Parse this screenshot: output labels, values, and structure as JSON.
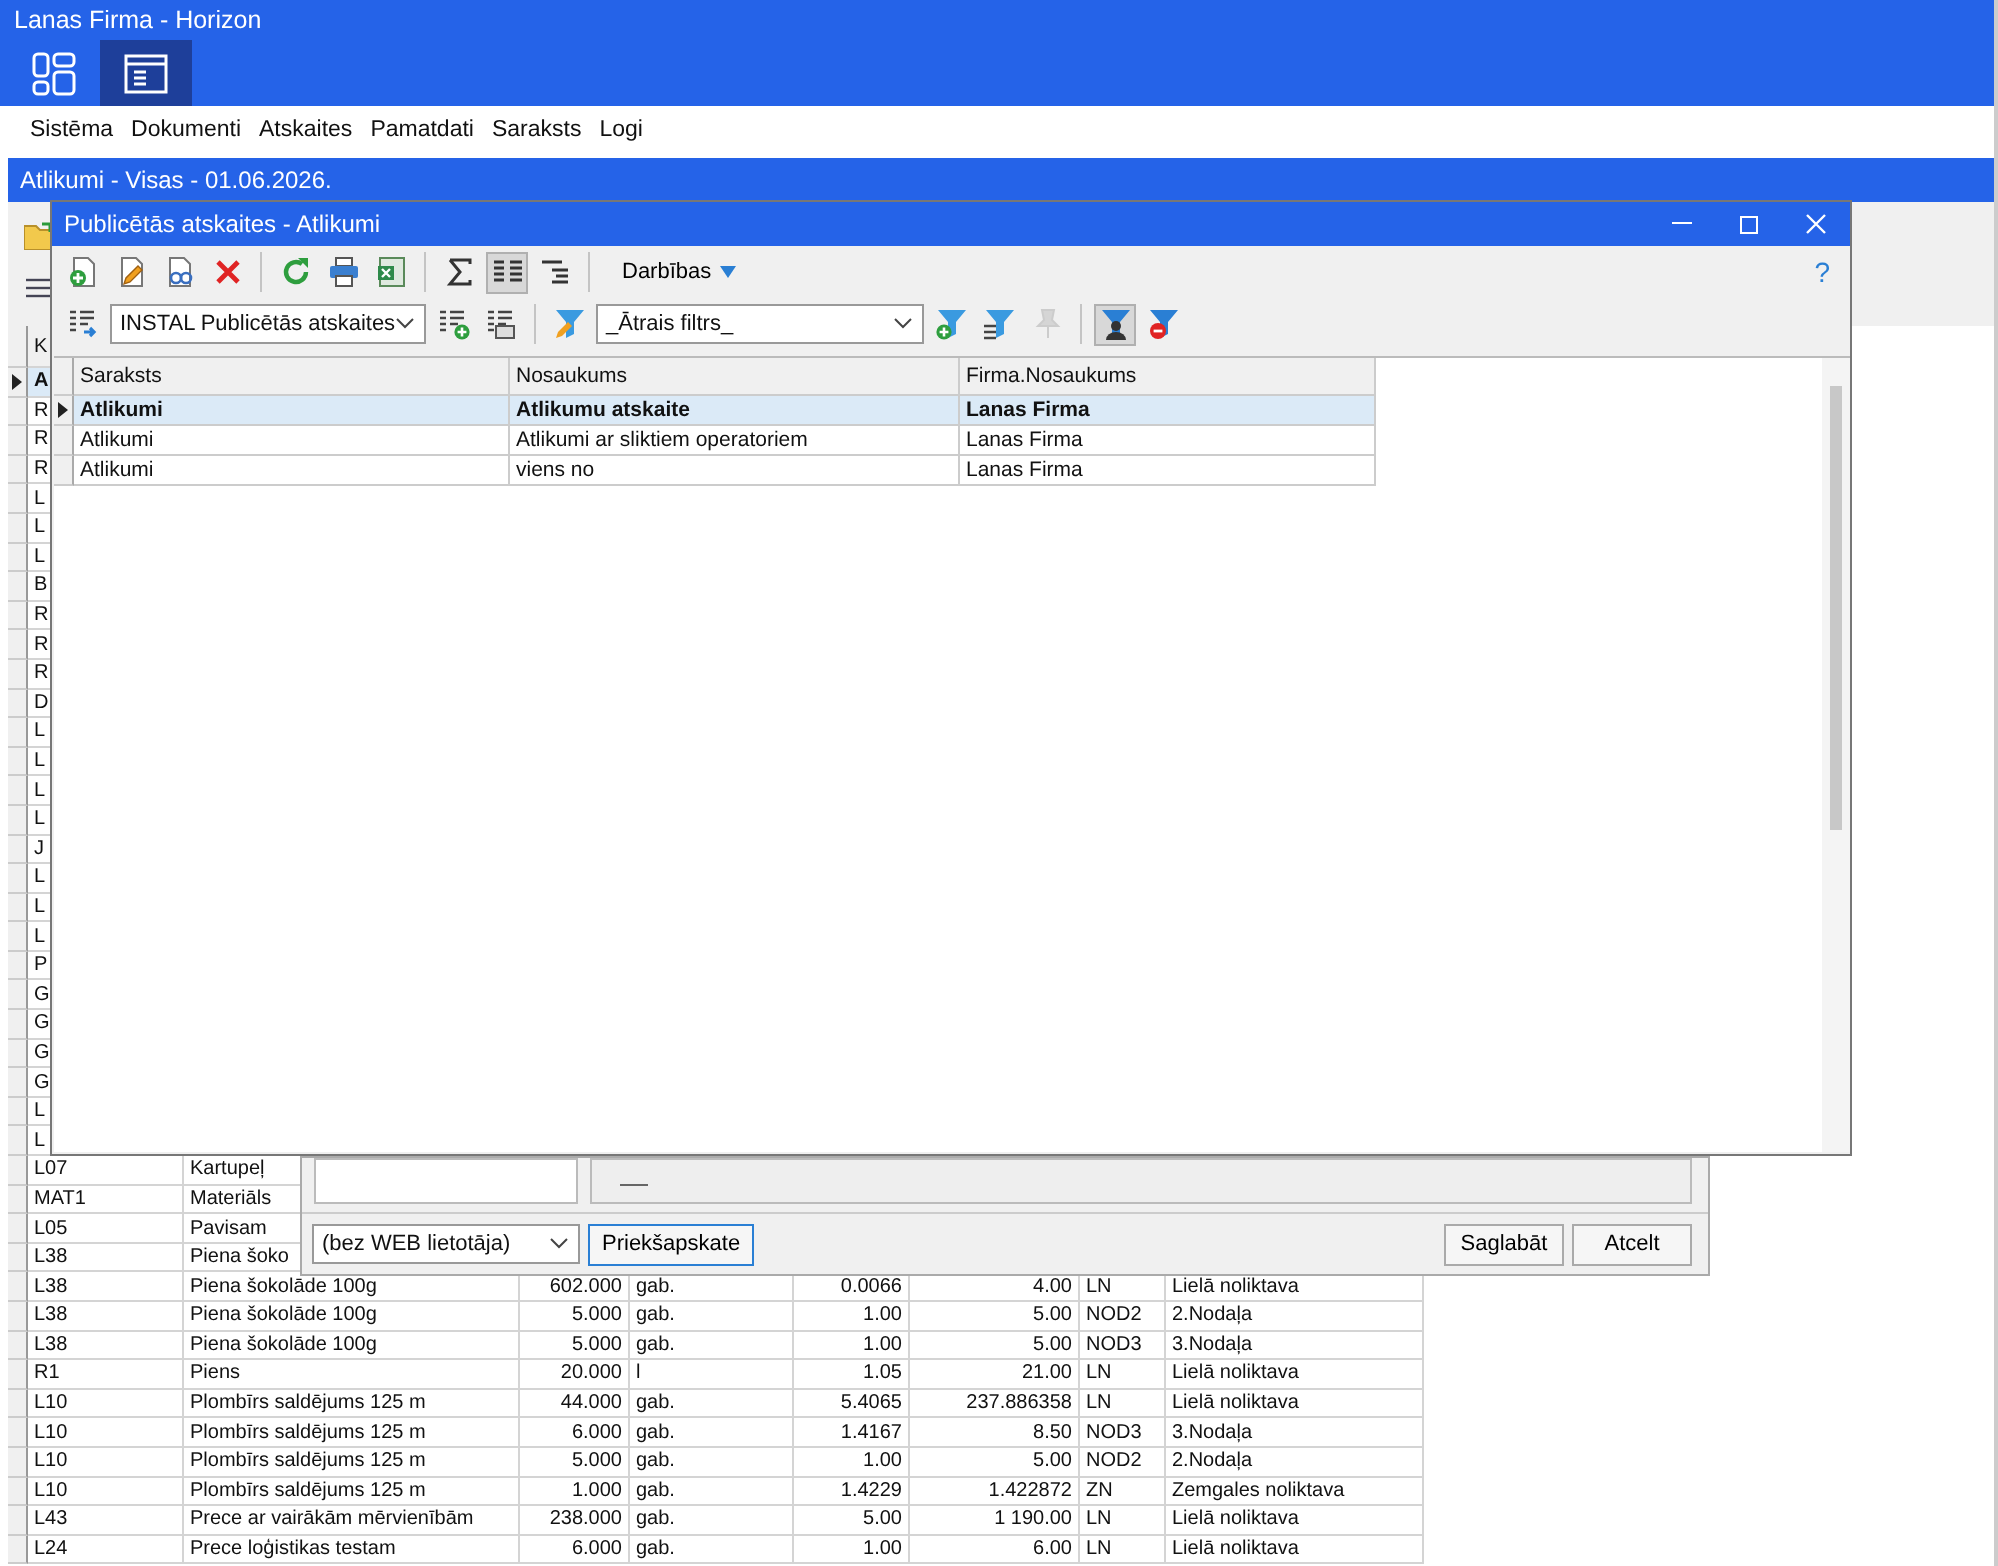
{
  "app": {
    "title": "Lanas Firma - Horizon"
  },
  "ribbon": [
    {
      "kind": "dashboard",
      "selected": false
    },
    {
      "kind": "window",
      "selected": true
    }
  ],
  "menu": [
    "Sistēma",
    "Dokumenti",
    "Atskaites",
    "Pamatdati",
    "Saraksts",
    "Logi"
  ],
  "stock_window": {
    "title": "Atlikumi - Visas - 01.06.2026.",
    "columns": [
      "K"
    ],
    "rows": [
      {
        "cells": [
          "A"
        ],
        "selected": true
      },
      {
        "cells": [
          "R"
        ],
        "selected": false
      },
      {
        "cells": [
          "R"
        ],
        "selected": false
      },
      {
        "cells": [
          "R"
        ],
        "selected": false
      },
      {
        "cells": [
          "L"
        ],
        "selected": false
      },
      {
        "cells": [
          "L"
        ],
        "selected": false
      },
      {
        "cells": [
          "L"
        ],
        "selected": false
      },
      {
        "cells": [
          "B"
        ],
        "selected": false
      },
      {
        "cells": [
          "R"
        ],
        "selected": false
      },
      {
        "cells": [
          "R"
        ],
        "selected": false
      },
      {
        "cells": [
          "R"
        ],
        "selected": false
      },
      {
        "cells": [
          "D"
        ],
        "selected": false
      },
      {
        "cells": [
          "L"
        ],
        "selected": false
      },
      {
        "cells": [
          "L"
        ],
        "selected": false
      },
      {
        "cells": [
          "L"
        ],
        "selected": false
      },
      {
        "cells": [
          "L"
        ],
        "selected": false
      },
      {
        "cells": [
          "J"
        ],
        "selected": false
      },
      {
        "cells": [
          "L"
        ],
        "selected": false
      },
      {
        "cells": [
          "L"
        ],
        "selected": false
      },
      {
        "cells": [
          "L"
        ],
        "selected": false
      },
      {
        "cells": [
          "P"
        ],
        "selected": false
      },
      {
        "cells": [
          "G"
        ],
        "selected": false
      },
      {
        "cells": [
          "G"
        ],
        "selected": false
      },
      {
        "cells": [
          "G"
        ],
        "selected": false
      },
      {
        "cells": [
          "G"
        ],
        "selected": false
      },
      {
        "cells": [
          "L"
        ],
        "selected": false
      },
      {
        "cells": [
          "L"
        ],
        "selected": false
      },
      {
        "cells": [
          "L07",
          "Kartupeļ"
        ],
        "selected": false
      },
      {
        "cells": [
          "MAT1",
          "Materiāls"
        ],
        "selected": false
      },
      {
        "cells": [
          "L05",
          "Pavisam"
        ],
        "selected": false
      },
      {
        "cells": [
          "L38",
          "Piena šoko"
        ],
        "selected": false
      },
      {
        "cells": [
          "L38",
          "Piena šokolāde 100g",
          "602.000",
          "gab.",
          "0.0066",
          "4.00",
          "LN",
          "Lielā noliktava"
        ],
        "selected": false
      },
      {
        "cells": [
          "L38",
          "Piena šokolāde 100g",
          "5.000",
          "gab.",
          "1.00",
          "5.00",
          "NOD2",
          "2.Nodaļa"
        ],
        "selected": false
      },
      {
        "cells": [
          "L38",
          "Piena šokolāde 100g",
          "5.000",
          "gab.",
          "1.00",
          "5.00",
          "NOD3",
          "3.Nodaļa"
        ],
        "selected": false
      },
      {
        "cells": [
          "R1",
          "Piens",
          "20.000",
          "l",
          "1.05",
          "21.00",
          "LN",
          "Lielā noliktava"
        ],
        "selected": false
      },
      {
        "cells": [
          "L10",
          "Plombīrs saldējums 125 m",
          "44.000",
          "gab.",
          "5.4065",
          "237.886358",
          "LN",
          "Lielā noliktava"
        ],
        "selected": false
      },
      {
        "cells": [
          "L10",
          "Plombīrs saldējums 125 m",
          "6.000",
          "gab.",
          "1.4167",
          "8.50",
          "NOD3",
          "3.Nodaļa"
        ],
        "selected": false
      },
      {
        "cells": [
          "L10",
          "Plombīrs saldējums 125 m",
          "5.000",
          "gab.",
          "1.00",
          "5.00",
          "NOD2",
          "2.Nodaļa"
        ],
        "selected": false
      },
      {
        "cells": [
          "L10",
          "Plombīrs saldējums 125 m",
          "1.000",
          "gab.",
          "1.4229",
          "1.422872",
          "ZN",
          "Zemgales noliktava"
        ],
        "selected": false
      },
      {
        "cells": [
          "L43",
          "Prece ar vairākām mērvienībām",
          "238.000",
          "gab.",
          "5.00",
          "1 190.00",
          "LN",
          "Lielā noliktava"
        ],
        "selected": false
      },
      {
        "cells": [
          "L24",
          "Prece loģistikas testam",
          "6.000",
          "gab.",
          "1.00",
          "6.00",
          "LN",
          "Lielā noliktava"
        ],
        "selected": false
      }
    ]
  },
  "report_dialog": {
    "web_user": "(bez WEB lietotāja)",
    "buttons": [
      {
        "label": "Priekšapskate",
        "focused": true
      },
      {
        "label": "Saglabāt",
        "focused": false
      },
      {
        "label": "Atcelt",
        "focused": false
      }
    ]
  },
  "published_reports": {
    "title": "Publicētās atskaites - Atlikumi",
    "help": "?",
    "toolbar": [
      {
        "kind": "new",
        "pressed": false
      },
      {
        "kind": "edit",
        "pressed": false
      },
      {
        "kind": "view",
        "pressed": false
      },
      {
        "kind": "delete",
        "pressed": false
      },
      {
        "kind": "separator"
      },
      {
        "kind": "refresh",
        "pressed": false
      },
      {
        "kind": "print",
        "pressed": false
      },
      {
        "kind": "export",
        "pressed": false
      },
      {
        "kind": "separator"
      },
      {
        "kind": "sum",
        "pressed": false
      },
      {
        "kind": "grid",
        "pressed": true
      },
      {
        "kind": "tree",
        "pressed": false
      },
      {
        "kind": "separator"
      },
      {
        "kind": "menu",
        "label": "Darbības"
      }
    ],
    "filter_bar": [
      {
        "kind": "layout",
        "pressed": false,
        "disabled": false
      },
      {
        "kind": "select",
        "value": "INSTAL Publicētās atskaites"
      },
      {
        "kind": "add-layout",
        "pressed": false,
        "disabled": false
      },
      {
        "kind": "layouts",
        "pressed": false,
        "disabled": false
      },
      {
        "kind": "separator"
      },
      {
        "kind": "filter-edit",
        "pressed": false,
        "disabled": false
      },
      {
        "kind": "select",
        "value": "_Ātrais filtrs_"
      },
      {
        "kind": "filter-add",
        "pressed": false,
        "disabled": false
      },
      {
        "kind": "filter-lines",
        "pressed": false,
        "disabled": false
      },
      {
        "kind": "filter-pin",
        "pressed": false,
        "disabled": true
      },
      {
        "kind": "separator"
      },
      {
        "kind": "filter-user",
        "pressed": true,
        "disabled": false
      },
      {
        "kind": "filter-remove",
        "pressed": false,
        "disabled": false
      }
    ],
    "columns": [
      "Saraksts",
      "Nosaukums",
      "Firma.Nosaukums"
    ],
    "rows": [
      {
        "cells": [
          "Atlikumi",
          "Atlikumu atskaite",
          "Lanas Firma"
        ],
        "selected": true
      },
      {
        "cells": [
          "Atlikumi",
          "Atlikumi ar sliktiem operatoriem",
          "Lanas Firma"
        ],
        "selected": false
      },
      {
        "cells": [
          "Atlikumi",
          "viens no",
          "Lanas Firma"
        ],
        "selected": false
      }
    ]
  }
}
